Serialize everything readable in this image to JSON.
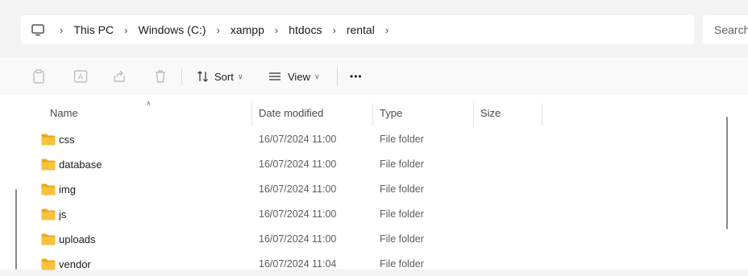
{
  "breadcrumb": {
    "items": [
      "This PC",
      "Windows (C:)",
      "xampp",
      "htdocs",
      "rental"
    ],
    "separator": "›"
  },
  "search": {
    "placeholder": "Search"
  },
  "toolbar": {
    "sort_label": "Sort",
    "view_label": "View",
    "more_label": "•••"
  },
  "columns": {
    "name": "Name",
    "date": "Date modified",
    "type": "Type",
    "size": "Size"
  },
  "files": [
    {
      "name": "css",
      "date": "16/07/2024 11:00",
      "type": "File folder"
    },
    {
      "name": "database",
      "date": "16/07/2024 11:00",
      "type": "File folder"
    },
    {
      "name": "img",
      "date": "16/07/2024 11:00",
      "type": "File folder"
    },
    {
      "name": "js",
      "date": "16/07/2024 11:00",
      "type": "File folder"
    },
    {
      "name": "uploads",
      "date": "16/07/2024 11:00",
      "type": "File folder"
    },
    {
      "name": "vendor",
      "date": "16/07/2024 11:04",
      "type": "File folder"
    }
  ],
  "colors": {
    "folder": "#f8c33a",
    "folder_dark": "#e8a91c"
  }
}
